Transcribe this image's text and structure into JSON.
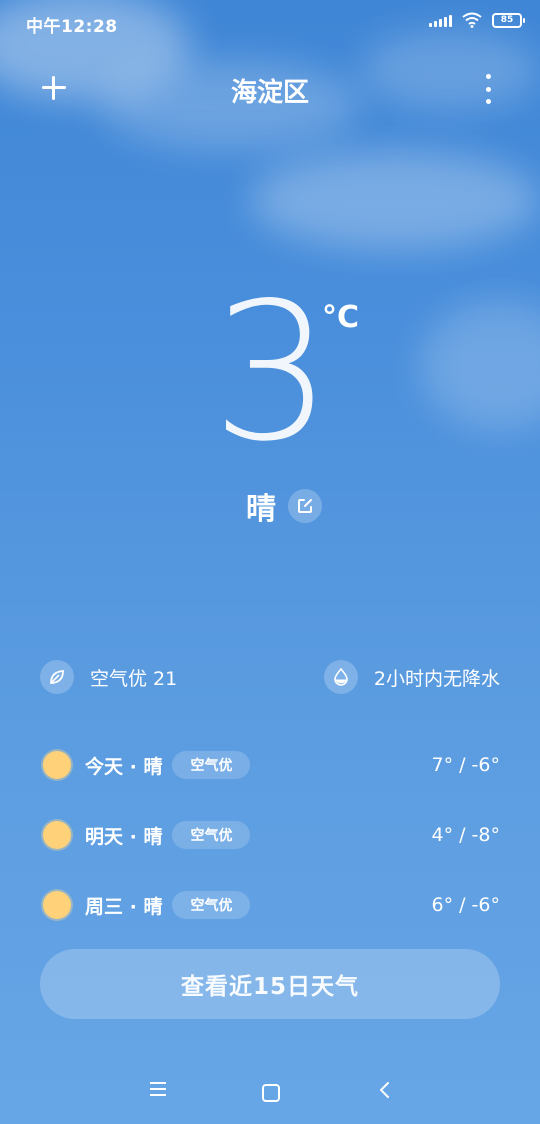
{
  "status_bar": {
    "time": "中午12:28",
    "battery": "85",
    "icons": [
      "signal-icon",
      "wifi-icon",
      "battery-icon"
    ]
  },
  "header": {
    "title": "海淀区",
    "add_icon": "plus-icon",
    "more_icon": "more-vertical-icon"
  },
  "current": {
    "temperature": "3",
    "unit": "°C",
    "condition": "晴"
  },
  "info": {
    "air_quality": "空气优 21",
    "precipitation": "2小时内无降水"
  },
  "forecast": [
    {
      "label": "今天 · 晴",
      "aqi": "空气优",
      "temp": "7° / -6°"
    },
    {
      "label": "明天 · 晴",
      "aqi": "空气优",
      "temp": "4° / -8°"
    },
    {
      "label": "周三 · 晴",
      "aqi": "空气优",
      "temp": "6° / -6°"
    }
  ],
  "cta": {
    "label": "查看近15日天气"
  },
  "colors": {
    "sky_top": "#3f86d6",
    "sky_bottom": "#67a6e6",
    "sun": "#ffd27a"
  }
}
